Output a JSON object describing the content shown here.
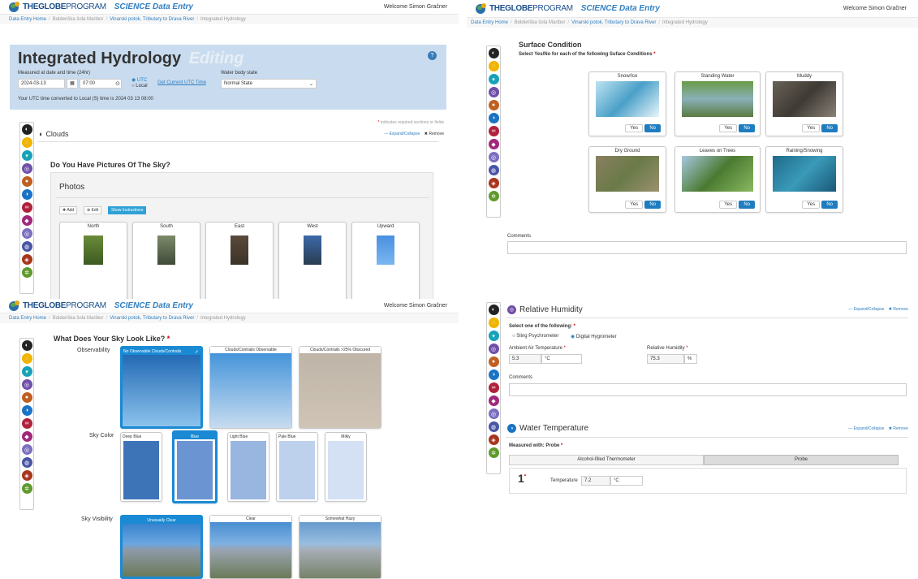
{
  "header": {
    "brand_a": "THE",
    "brand_b": "GLOBE",
    "brand_c": "PROGRAM",
    "science": "SCIENCE Data Entry",
    "welcome_1": "Welcome Simon Gračner",
    "welcome_2": "Welcome Simon Gračner",
    "welcome_3": "Welcome Simon Gračner"
  },
  "breadcrumbs": {
    "home": "Data Entry Home",
    "site": "Bolderiška šola Maribor",
    "river": "Vinarski potok, Tributary to Drava River",
    "page": "Integrated Hydrology"
  },
  "hydrology": {
    "title": "Integrated Hydrology",
    "mode": "Editing",
    "measured_label": "Measured at date and time (24hr)",
    "date_value": "2024-03-13",
    "time_value": "07:00",
    "utc_label": "UTC",
    "local_label": "Local",
    "get_utc": "Get Current UTC Time",
    "water_body_label": "Water body state",
    "water_body_value": "Normal State",
    "utc_note": "Your UTC time converted to Local (S) time is 2024 03 13 08:00"
  },
  "clouds": {
    "required_note": "indicates required sections or fields",
    "section": "Clouds",
    "expand": "Expand/Collapse",
    "remove": "Remove",
    "question": "Do You Have Pictures Of The Sky?",
    "photos_title": "Photos",
    "add": "Add",
    "edit": "Edit",
    "instructions": "Show Instructions",
    "photos": [
      "North",
      "South",
      "East",
      "West",
      "Upward"
    ]
  },
  "sky": {
    "question": "What Does Your Sky Look Like?",
    "observability_label": "Observability",
    "observability": [
      "No Observable Clouds/Contrails",
      "Clouds/Contrails Observable",
      "Clouds/Contrails >25% Obscured"
    ],
    "color_label": "Sky Color",
    "colors": [
      "Deep Blue",
      "Blue",
      "Light Blue",
      "Pale Blue",
      "Milky"
    ],
    "visibility_label": "Sky Visibility",
    "visibility": [
      "Unusually Clear",
      "Clear",
      "Somewhat Hazy"
    ]
  },
  "surface": {
    "title": "Surface Condition",
    "instruction": "Select Yes/No for each of the following Suface Conditions",
    "conditions": [
      "Snow/Ice",
      "Standing Water",
      "Muddy",
      "Dry Ground",
      "Leaves on Trees",
      "Raining/Snowing"
    ],
    "yes": "Yes",
    "no": "No",
    "comments": "Comments"
  },
  "humidity": {
    "section": "Relative Humidity",
    "expand": "Expand/Collapse",
    "remove": "Remove",
    "select_label": "Select one of the following:",
    "option1": "Sling Psychrometer",
    "option2": "Digital Hygrometer",
    "air_temp_label": "Ambient Air Temperature",
    "air_temp_value": "5.3",
    "air_temp_unit": "°C",
    "rh_label": "Relative Humidity",
    "rh_value": "75.3",
    "rh_unit": "%",
    "comments": "Comments"
  },
  "water_temp": {
    "section": "Water Temperature",
    "expand": "Expand/Collapse",
    "remove": "Remove",
    "measured_with": "Measured with: Probe",
    "tab1": "Alcohol-filled Thermometer",
    "tab2": "Probe",
    "row_num": "1",
    "temp_label": "Temperature",
    "temp_value": "7.2",
    "temp_unit": "°C"
  },
  "colors": {
    "accent": "#1f7dbf",
    "header_band": "#c9dcef",
    "selected_border": "#1a8ad4"
  }
}
